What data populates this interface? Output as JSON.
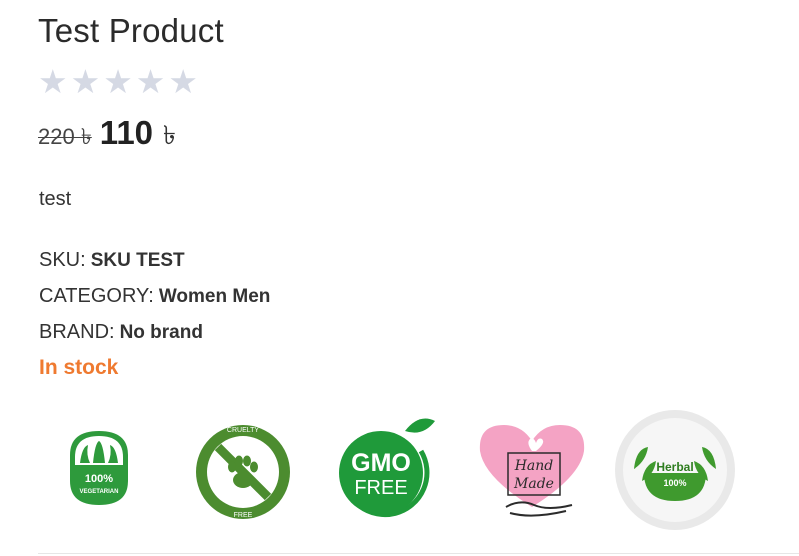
{
  "product": {
    "title": "Test Product",
    "rating": {
      "max": 5,
      "value": 0
    },
    "old_price": "220 ৳",
    "new_price": "110",
    "currency": "৳",
    "description": "test",
    "sku_label": "SKU:",
    "sku_value": "SKU TEST",
    "category_label": "CATEGORY:",
    "category_value": "Women Men",
    "brand_label": "BRAND:",
    "brand_value": "No brand",
    "stock_status": "In stock"
  },
  "badges": {
    "vegetarian": {
      "icon": "vegetarian-badge-icon",
      "line1": "100%",
      "line2": "VEGETARIAN"
    },
    "cruelty": {
      "icon": "cruelty-free-badge-icon",
      "top": "CRUELTY",
      "bottom": "FREE"
    },
    "gmo": {
      "icon": "gmo-free-badge-icon",
      "line1": "GMO",
      "line2": "FREE"
    },
    "handmade": {
      "icon": "hand-made-badge-icon",
      "line1": "Hand",
      "line2": "Made"
    },
    "herbal": {
      "icon": "herbal-badge-icon",
      "line1": "Herbal",
      "line2": "100%"
    }
  },
  "colors": {
    "stock": "#ef7a30",
    "star_empty": "#d5d9e4",
    "badge_green": "#2e9a3c",
    "heart_pink": "#f4a3c4"
  }
}
